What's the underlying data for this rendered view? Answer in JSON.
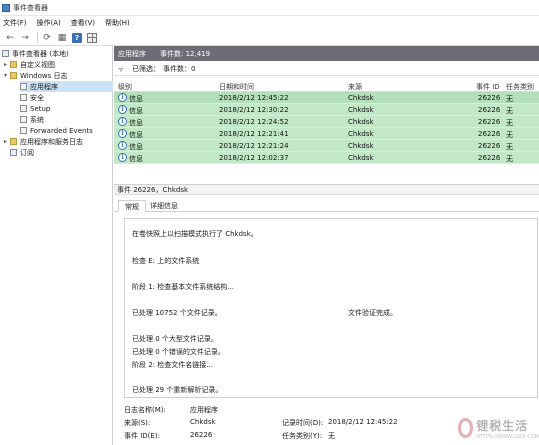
{
  "window": {
    "title": "事件查看器"
  },
  "menu": [
    "文件(F)",
    "操作(A)",
    "查看(V)",
    "帮助(H)"
  ],
  "toolbar": {
    "buttons": [
      {
        "name": "back-icon",
        "glyph": "←"
      },
      {
        "name": "forward-icon",
        "glyph": "→"
      },
      {
        "name": "refresh-icon",
        "glyph": "⟳"
      },
      {
        "name": "properties-icon",
        "glyph": "▦"
      },
      {
        "name": "help-icon",
        "glyph": "?"
      },
      {
        "name": "view-icon",
        "glyph": ""
      }
    ]
  },
  "tree": {
    "root": "事件查看器 (本地)",
    "items": [
      {
        "label": "自定义视图"
      },
      {
        "label": "Windows 日志"
      },
      {
        "label": "应用程序"
      },
      {
        "label": "安全"
      },
      {
        "label": "Setup"
      },
      {
        "label": "系统"
      },
      {
        "label": "Forwarded Events"
      },
      {
        "label": "应用程序和服务日志"
      },
      {
        "label": "订阅"
      }
    ]
  },
  "log": {
    "name": "应用程序",
    "count": "事件数: 12,419",
    "filter_label": "已筛选：",
    "filter_count": "事件数：0"
  },
  "table": {
    "headers": [
      "级别",
      "日期和时间",
      "来源",
      "事件 ID",
      "任务类别"
    ],
    "rows": [
      {
        "level": "信息",
        "date": "2018/2/12 12:45:22",
        "source": "Chkdsk",
        "id": "26226",
        "task": "无"
      },
      {
        "level": "信息",
        "date": "2018/2/12 12:30:22",
        "source": "Chkdsk",
        "id": "26226",
        "task": "无"
      },
      {
        "level": "信息",
        "date": "2018/2/12 12:24:52",
        "source": "Chkdsk",
        "id": "26226",
        "task": "无"
      },
      {
        "level": "信息",
        "date": "2018/2/12 12:21:41",
        "source": "Chkdsk",
        "id": "26226",
        "task": "无"
      },
      {
        "level": "信息",
        "date": "2018/2/12 12:21:24",
        "source": "Chkdsk",
        "id": "26226",
        "task": "无"
      },
      {
        "level": "信息",
        "date": "2018/2/12 12:02:37",
        "source": "Chkdsk",
        "id": "26226",
        "task": "无"
      }
    ]
  },
  "detail": {
    "title": "事件 26226，Chkdsk",
    "tabs": [
      "常规",
      "详细信息"
    ],
    "lines": [
      "在卷快照上以扫描模式执行了 Chkdsk。",
      "检查 E: 上的文件系统",
      "阶段 1: 检查基本文件系统结构...",
      "已处理 10752 个文件记录。",
      "文件验证完成。",
      "已处理 0 个大型文件记录。",
      "已处理 0 个错误的文件记录。",
      "阶段 2: 检查文件名链接...",
      "已处理 29 个重新解析记录。"
    ],
    "fields": {
      "log_name_label": "日志名称(M):",
      "log_name": "应用程序",
      "source_label": "来源(S):",
      "source": "Chkdsk",
      "logged_label": "记录时间(D):",
      "logged": "2018/2/12 12:45:22",
      "event_id_label": "事件 ID(E):",
      "event_id": "26226",
      "task_label": "任务类别(Y):",
      "task": "无"
    }
  },
  "watermark": {
    "main": "锂税生活",
    "sub": "HTTPS://WWW.LSSX.COM"
  }
}
